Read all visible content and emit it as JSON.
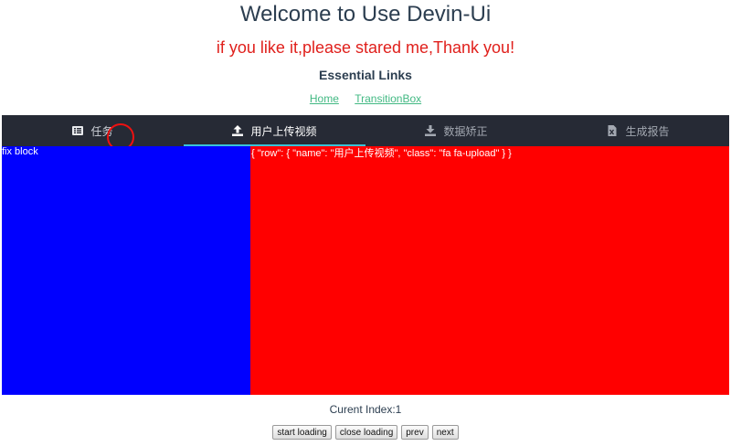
{
  "header": {
    "title": "Welcome to Use Devin-Ui",
    "subtitle": "if you like it,please stared me,Thank you!",
    "links_heading": "Essential Links",
    "links": [
      "Home",
      "TransitionBox"
    ]
  },
  "tabs": [
    {
      "label": "任务",
      "icon": "list-icon",
      "state": "normal"
    },
    {
      "label": "用户上传视频",
      "icon": "upload-icon",
      "state": "active"
    },
    {
      "label": "数据矫正",
      "icon": "download-icon",
      "state": "muted"
    },
    {
      "label": "生成报告",
      "icon": "file-excel-icon",
      "state": "muted"
    }
  ],
  "colors": {
    "tabbar_bg": "#262a35",
    "active_underline": "#39c2d7",
    "fix_block_bg": "#0000ff",
    "panel_bg": "#ff0000",
    "subtitle": "#e0201c",
    "link": "#42b983"
  },
  "content": {
    "fix_block_label": "fix block",
    "panel_text": "{ \"row\": { \"name\": \"用户上传视频\", \"class\": \"fa fa-upload\" } }"
  },
  "status": {
    "current_index_text": "Curent Index:1"
  },
  "controls": {
    "start_loading": "start loading",
    "close_loading": "close loading",
    "prev": "prev",
    "next": "next"
  }
}
